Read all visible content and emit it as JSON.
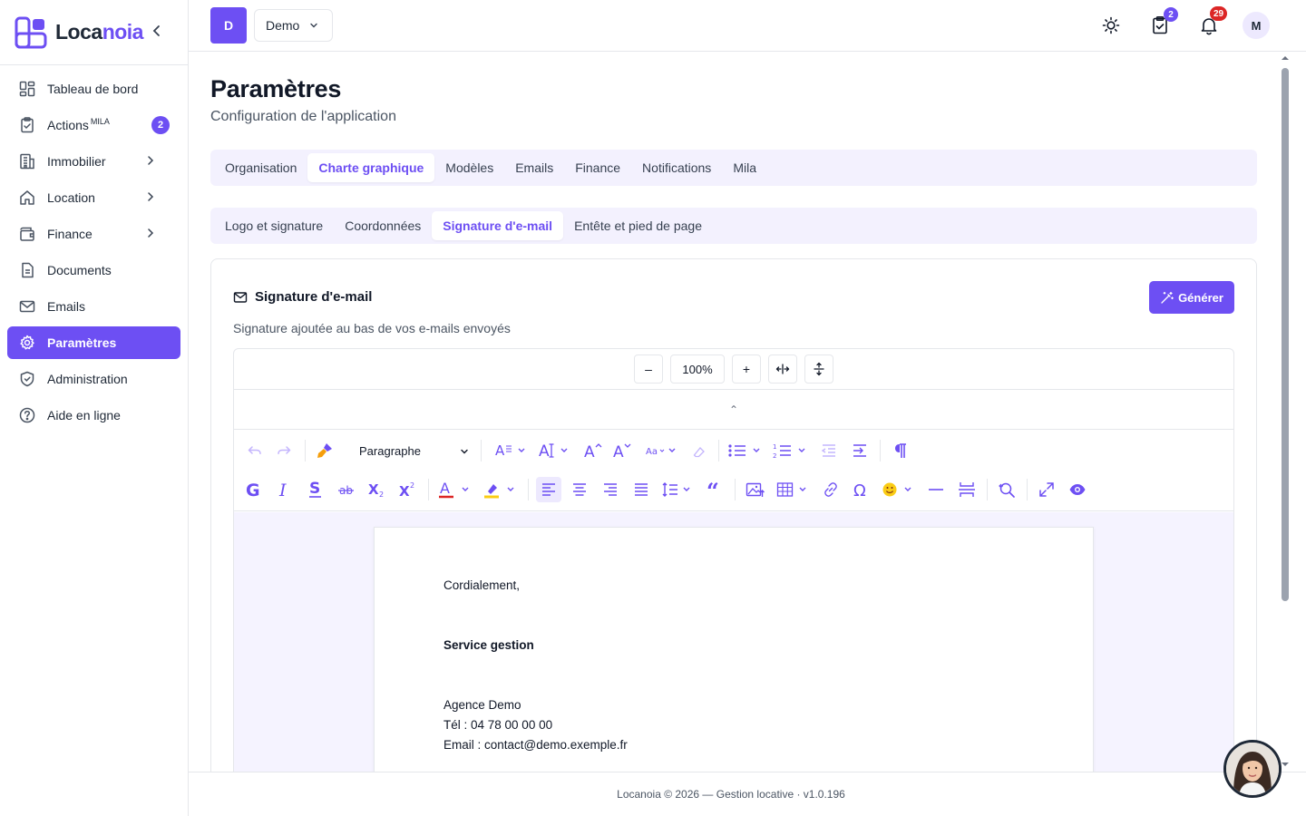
{
  "brand": {
    "name_main": "Loca",
    "name_accent": "noia",
    "collapse_icon": "chevron-left-icon",
    "accent_color": "#6d4ff3"
  },
  "sidebar": {
    "items": [
      {
        "label": "Tableau de bord",
        "icon": "dashboard-icon"
      },
      {
        "label": "Actions",
        "sup": "MILA",
        "badge": "2",
        "icon": "clipboard-check-icon"
      },
      {
        "label": "Immobilier",
        "icon": "building-icon",
        "expandable": true
      },
      {
        "label": "Location",
        "icon": "home-icon",
        "expandable": true
      },
      {
        "label": "Finance",
        "icon": "wallet-icon",
        "expandable": true
      },
      {
        "label": "Documents",
        "icon": "document-icon"
      },
      {
        "label": "Emails",
        "icon": "mail-icon"
      },
      {
        "label": "Paramètres",
        "icon": "gear-icon",
        "active": true
      },
      {
        "label": "Administration",
        "icon": "shield-icon"
      },
      {
        "label": "Aide en ligne",
        "icon": "help-circle-icon"
      }
    ]
  },
  "topbar": {
    "org_initial": "D",
    "org_name": "Demo",
    "tasks_badge": "2",
    "notifications_badge": "29",
    "user_initial": "M",
    "badge_task_color": "#6d4ff3",
    "badge_notif_color": "#dc2626"
  },
  "page": {
    "title": "Paramètres",
    "subtitle": "Configuration de l'application"
  },
  "tabs": [
    {
      "label": "Organisation"
    },
    {
      "label": "Charte graphique",
      "active": true
    },
    {
      "label": "Modèles"
    },
    {
      "label": "Emails"
    },
    {
      "label": "Finance"
    },
    {
      "label": "Notifications"
    },
    {
      "label": "Mila"
    }
  ],
  "subtabs": [
    {
      "label": "Logo et signature"
    },
    {
      "label": "Coordonnées"
    },
    {
      "label": "Signature d'e-mail",
      "active": true
    },
    {
      "label": "Entête et pied de page"
    }
  ],
  "card": {
    "title": "Signature d'e-mail",
    "description": "Signature ajoutée au bas de vos e-mails envoyés",
    "generate_label": "Générer"
  },
  "editor": {
    "zoom_minus": "–",
    "zoom_value": "100%",
    "zoom_plus": "+",
    "collapse_caret": "⌃",
    "paragraph_style": "Paragraphe",
    "content": {
      "line1": "Cordialement,",
      "line2": "Service gestion",
      "line3": "Agence Demo",
      "line4": "Tél : 04 78 00 00 00",
      "line5": "Email : contact@demo.exemple.fr"
    }
  },
  "footer": {
    "text": "Locanoia © 2026 — Gestion locative · v1.0.196"
  }
}
